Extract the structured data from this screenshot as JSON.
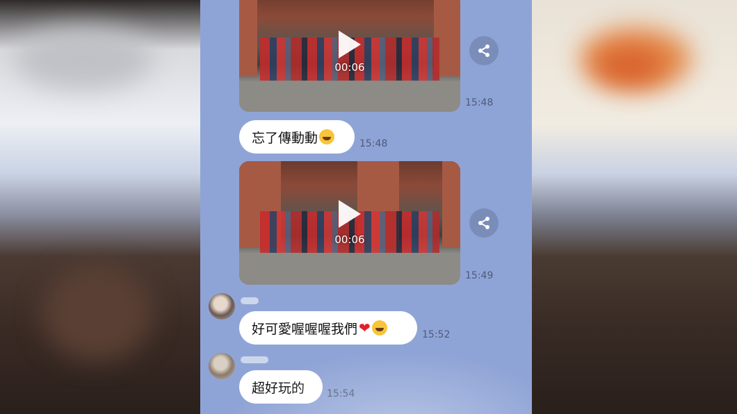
{
  "video_messages": [
    {
      "duration": "00:06",
      "time": "15:48"
    },
    {
      "duration": "00:06",
      "time": "15:49"
    }
  ],
  "text_messages": [
    {
      "text": "忘了傳動動",
      "emoji": "grinning-squinting-face",
      "time": "15:48"
    },
    {
      "text": "好可愛喔喔喔我們",
      "emoji": "heart-and-grinning-squinting-face",
      "time": "15:52"
    },
    {
      "text": "超好玩的",
      "time": "15:54"
    }
  ],
  "icons": [
    "play-icon",
    "share-icon",
    "heart-emoji",
    "laughing-emoji"
  ],
  "colors": {
    "chat_background": "#8fa4d6",
    "bubble": "#ffffff",
    "share_button": "#7a8db9",
    "timestamp": "#4e5a78",
    "heart": "#e0202c"
  }
}
